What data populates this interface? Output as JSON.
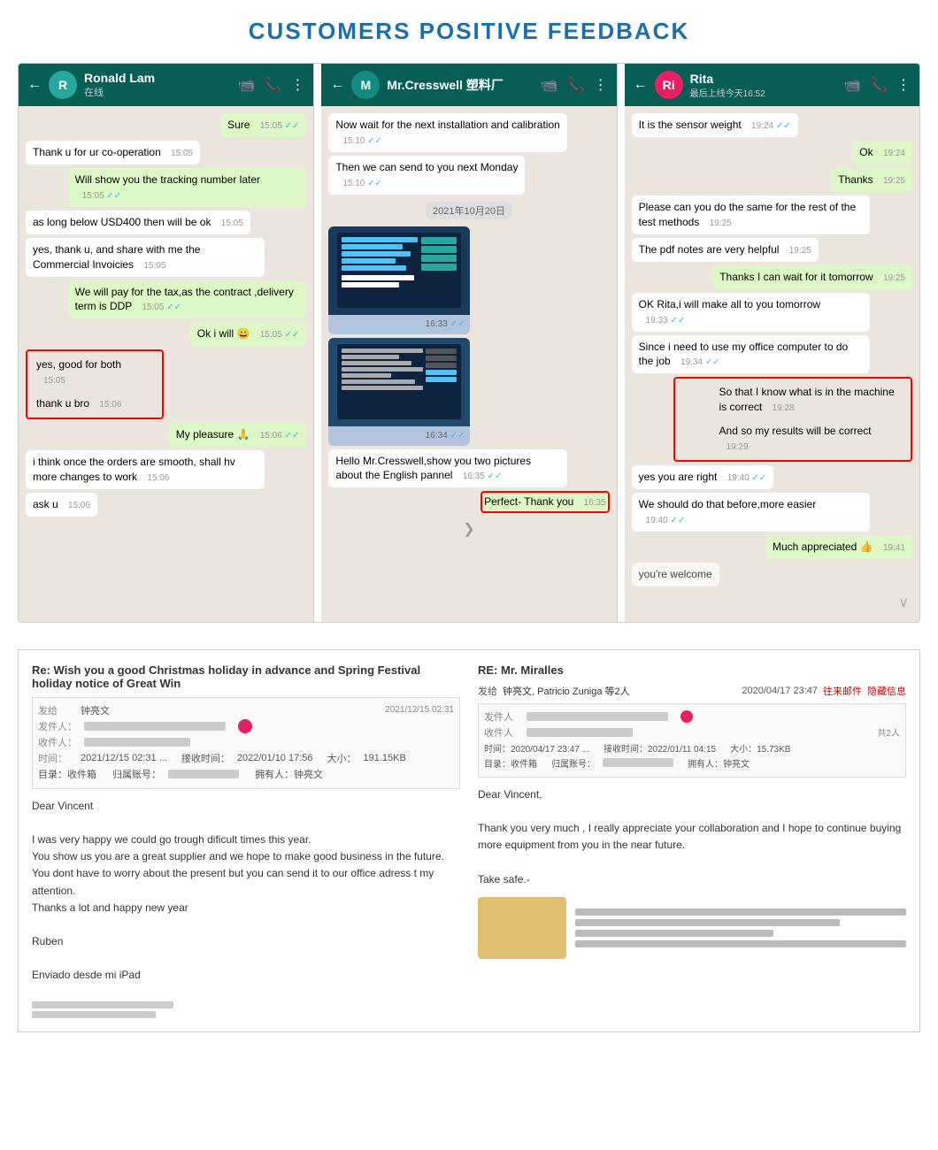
{
  "page": {
    "title": "CUSTOMERS POSITIVE FEEDBACK"
  },
  "chat1": {
    "contact_name": "Ronald Lam",
    "contact_status": "在线",
    "avatar": "R",
    "messages": [
      {
        "type": "sent",
        "text": "Sure",
        "time": "15:05",
        "tick": "✓✓"
      },
      {
        "type": "received",
        "text": "Thank u for ur co-operation",
        "time": "15:05"
      },
      {
        "type": "sent",
        "text": "Will show you the tracking number later",
        "time": "15:05",
        "tick": "✓✓"
      },
      {
        "type": "received",
        "text": "as long below USD400 then will be ok",
        "time": "15:05"
      },
      {
        "type": "received",
        "text": "yes, thank u, and share with me the Commercial Invoicies",
        "time": "15:05"
      },
      {
        "type": "sent",
        "text": "We will pay for the tax,as the contract ,delivery term is DDP",
        "time": "15:05",
        "tick": "✓✓"
      },
      {
        "type": "sent",
        "text": "Ok i will 😀",
        "time": "15:05",
        "tick": "✓✓"
      },
      {
        "type": "received",
        "text": "yes, good for both",
        "time": "15:05",
        "highlight": true
      },
      {
        "type": "received",
        "text": "thank u bro",
        "time": "15:06",
        "highlight": true
      },
      {
        "type": "sent",
        "text": "My pleasure 🙏",
        "time": "15:06",
        "tick": "✓✓"
      },
      {
        "type": "received",
        "text": "i think once the orders are smooth, shall hv more changes to work",
        "time": "15:06"
      },
      {
        "type": "received",
        "text": "ask u",
        "time": "15:06"
      }
    ]
  },
  "chat2": {
    "contact_name": "Mr.Cresswell 塑料厂",
    "contact_status": "",
    "avatar": "M",
    "messages": [
      {
        "type": "received",
        "text": "Now wait for the next installation and calibration",
        "time": "15:10",
        "tick": "✓✓"
      },
      {
        "type": "received",
        "text": "Then we can send to you next Monday",
        "time": "15:10",
        "tick": "✓✓"
      },
      {
        "type": "date",
        "text": "2021年10月20日"
      },
      {
        "type": "image",
        "time": "16:33",
        "tick": "✓✓"
      },
      {
        "type": "image2",
        "time": "16:34",
        "tick": "✓✓"
      },
      {
        "type": "received",
        "text": "Hello Mr.Cresswell,show you two pictures about the English pannel",
        "time": "16:35",
        "tick": "✓✓"
      },
      {
        "type": "sent",
        "text": "Perfect- Thank you",
        "time": "16:35",
        "highlight": true
      }
    ]
  },
  "chat3": {
    "contact_name": "Rita",
    "contact_status": "最后上线今天16:52",
    "avatar": "Ri",
    "messages": [
      {
        "type": "received",
        "text": "It is the sensor weight",
        "time": "19:24",
        "tick": "✓✓"
      },
      {
        "type": "sent",
        "text": "Ok",
        "time": "19:24"
      },
      {
        "type": "sent",
        "text": "Thanks",
        "time": "19:25"
      },
      {
        "type": "received",
        "text": "Please can you do the same for the rest of the test methods",
        "time": "19:25"
      },
      {
        "type": "received",
        "text": "The pdf notes are very helpful",
        "time": "19:25"
      },
      {
        "type": "sent",
        "text": "Thanks I can wait for it tomorrow",
        "time": "19:25"
      },
      {
        "type": "received",
        "text": "OK Rita,i will make all to you tomorrow",
        "time": "19:33",
        "tick": "✓✓"
      },
      {
        "type": "received",
        "text": "Since i need to use my office computer to do the job",
        "time": "19:34",
        "tick": "✓✓"
      },
      {
        "type": "sent",
        "text": "So that I know what is in the machine is correct",
        "time": "19:28",
        "highlight": true
      },
      {
        "type": "sent",
        "text": "And so my results will be correct",
        "time": "19:29",
        "highlight": true
      },
      {
        "type": "received",
        "text": "yes you are right",
        "time": "19:40",
        "tick": "✓✓"
      },
      {
        "type": "received",
        "text": "We should do that before,more easier",
        "time": "19:40",
        "tick": "✓✓"
      },
      {
        "type": "sent",
        "text": "Much appreciated 👍",
        "time": "19:41"
      },
      {
        "type": "received",
        "text": "you're welcome",
        "time": ""
      }
    ]
  },
  "email1": {
    "subject": "Re: Wish you a good Christmas holiday in advance and Spring Festival holiday notice of Great Win",
    "sender_label": "发给",
    "sender_name": "钟亮文",
    "from_label": "发件人：",
    "to_label": "收件人：",
    "time_label": "时间：",
    "recv_label": "接收时间：",
    "size_label": "大小：",
    "dir_label": "目录：收件箱",
    "return_label": "归属账号：",
    "owner_label": "拥有人：钟亮文",
    "date_sent": "2021/12/15 02:31",
    "date_recv": "2022/01/10 17:56",
    "size": "191.15KB",
    "body_greeting": "Dear Vincent",
    "body_text": "I was very happy we could go trough dificult times this year.\nYou show us you are a great supplier and we hope to make good business in the future.  You dont have to worry about the present but you can send it to our office adress t my attention.\nThanks a lot and happy new year",
    "signature": "Ruben",
    "postscript": "Enviado desde mi iPad",
    "footer_blurred": "blurred text footer"
  },
  "email2": {
    "subject": "RE: Mr. Miralles",
    "sender_label": "发给",
    "sender_names": "钟亮文, Patricio Zuniga 等2人",
    "date_sent": "2020/04/17 23:47",
    "type_label": "往来邮件",
    "hide_label": "隐藏信息",
    "from_label": "发件人",
    "to_label": "收件人",
    "count_label": "共2人",
    "time_label": "时间：2020/04/17 23:47 ...",
    "recv_label": "接收时间：2022/01/11 04:15",
    "size_label": "大小：15.73KB",
    "dir_label": "目录：收件箱",
    "account_label": "归属账号：",
    "owner_label": "拥有人：钟亮文",
    "greeting": "Dear Vincent,",
    "body_text": "Thank you very much , I really appreciate your collaboration and I hope to continue buying more equipment from you in the near future.",
    "closing": "Take safe.-"
  },
  "icons": {
    "back_arrow": "←",
    "video_call": "📹",
    "phone": "📞",
    "more": "⋮",
    "check_double": "✓✓",
    "check_single": "✓",
    "scroll_down": "❯"
  }
}
